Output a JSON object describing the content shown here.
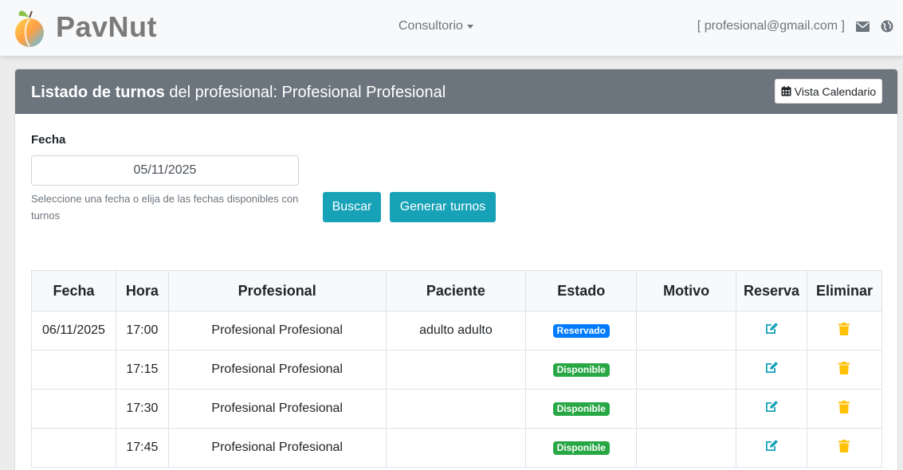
{
  "navbar": {
    "brand": "PavNut",
    "menu_label": "Consultorio",
    "user_email": "[ profesional@gmail.com ]",
    "icons": [
      "envelope-icon",
      "globe-icon"
    ]
  },
  "card": {
    "title_bold": "Listado de turnos",
    "title_rest": " del profesional: Profesional Profesional",
    "calendar_button": "Vista Calendario"
  },
  "form": {
    "date_label": "Fecha",
    "date_value": "05/11/2025",
    "help_text": "Seleccione una fecha o elija de las fechas disponibles con turnos",
    "search_button": "Buscar",
    "generate_button": "Generar turnos"
  },
  "table": {
    "headers": [
      "Fecha",
      "Hora",
      "Profesional",
      "Paciente",
      "Estado",
      "Motivo",
      "Reserva",
      "Eliminar"
    ],
    "rows": [
      {
        "fecha": "06/11/2025",
        "hora": "17:00",
        "profesional": "Profesional Profesional",
        "paciente": "adulto adulto",
        "estado": "Reservado",
        "motivo": ""
      },
      {
        "fecha": "",
        "hora": "17:15",
        "profesional": "Profesional Profesional",
        "paciente": "",
        "estado": "Disponible",
        "motivo": ""
      },
      {
        "fecha": "",
        "hora": "17:30",
        "profesional": "Profesional Profesional",
        "paciente": "",
        "estado": "Disponible",
        "motivo": ""
      },
      {
        "fecha": "",
        "hora": "17:45",
        "profesional": "Profesional Profesional",
        "paciente": "",
        "estado": "Disponible",
        "motivo": ""
      }
    ]
  },
  "colors": {
    "header_bg": "#6c757d",
    "info": "#17a2b8",
    "reservado": "#007bff",
    "disponible": "#28a745",
    "delete": "#ffc107"
  }
}
